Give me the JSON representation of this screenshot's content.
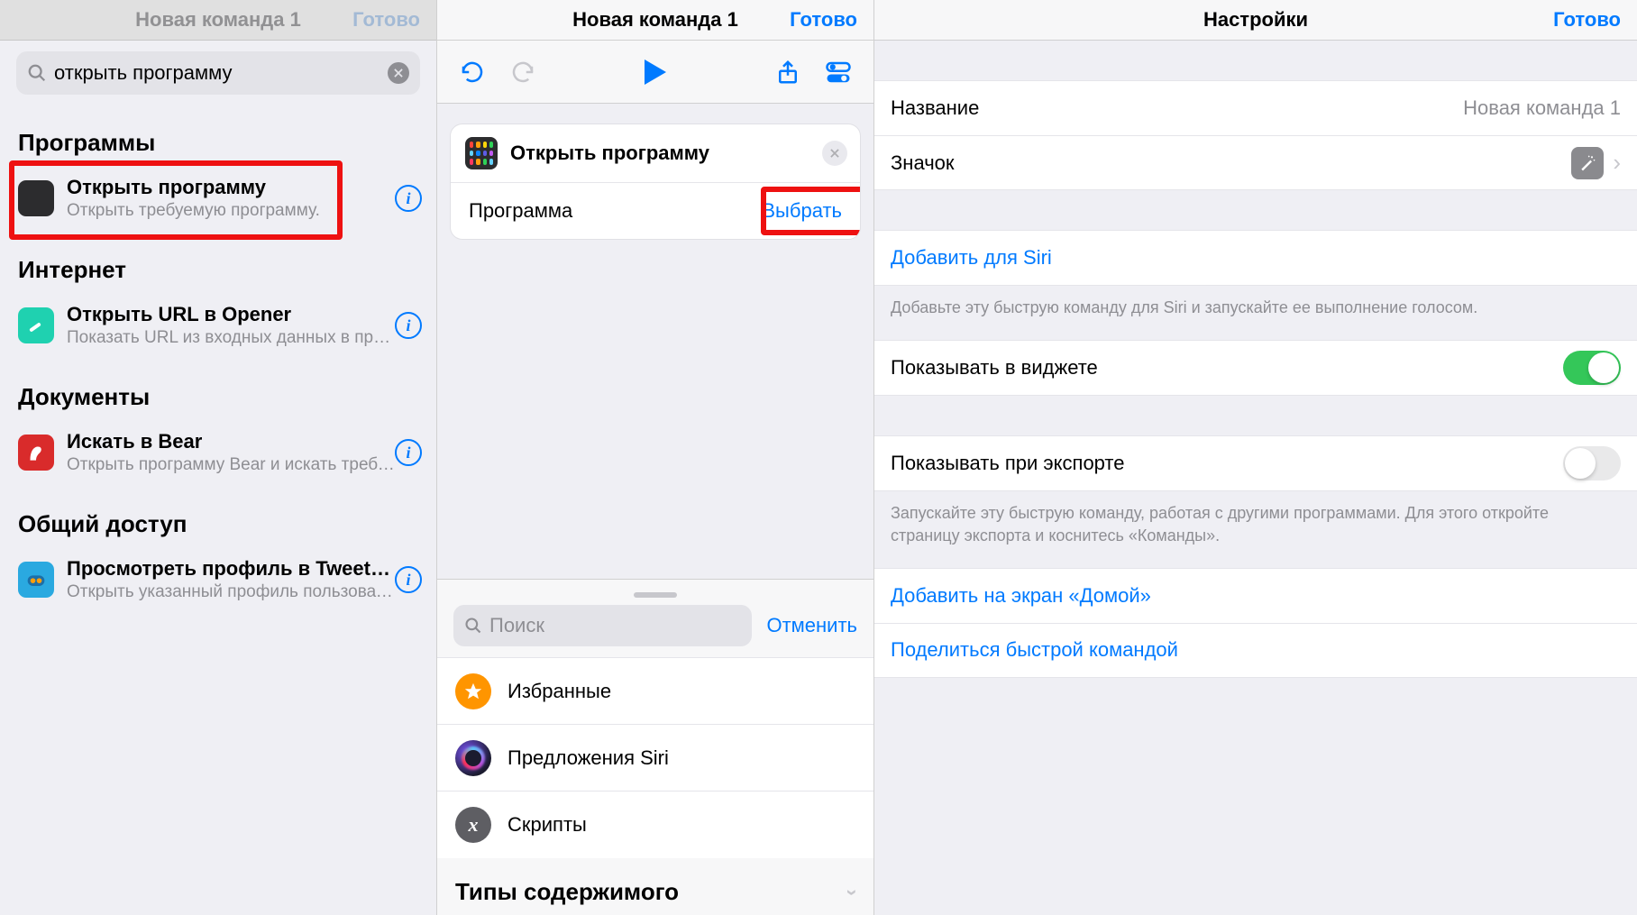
{
  "col1": {
    "header_title": "Новая команда 1",
    "header_done": "Готово",
    "search_value": "открыть программу",
    "sections": [
      {
        "title": "Программы",
        "items": [
          {
            "icon": "app-grid",
            "title": "Открыть программу",
            "sub": "Открыть требуемую программу."
          }
        ]
      },
      {
        "title": "Интернет",
        "items": [
          {
            "icon": "opener",
            "title": "Открыть URL в Opener",
            "sub": "Показать URL из входных данных в прог…"
          }
        ]
      },
      {
        "title": "Документы",
        "items": [
          {
            "icon": "bear",
            "title": "Искать в Bear",
            "sub": "Открыть программу Bear и искать требу…"
          }
        ]
      },
      {
        "title": "Общий доступ",
        "items": [
          {
            "icon": "tweetbot",
            "title": "Просмотреть профиль в Tweet…",
            "sub": "Открыть указанный профиль пользовате…"
          }
        ]
      }
    ]
  },
  "col2": {
    "header_title": "Новая команда 1",
    "header_done": "Готово",
    "card": {
      "title": "Открыть программу",
      "param_label": "Программа",
      "param_value": "Выбрать"
    },
    "drawer": {
      "search_placeholder": "Поиск",
      "cancel": "Отменить",
      "items": [
        {
          "icon": "star",
          "color": "#ff9500",
          "label": "Избранные"
        },
        {
          "icon": "siri",
          "color": "siri",
          "label": "Предложения Siri"
        },
        {
          "icon": "script",
          "color": "#5e5e63",
          "label": "Скрипты"
        }
      ],
      "section2": "Типы содержимого"
    }
  },
  "col3": {
    "header_title": "Настройки",
    "header_done": "Готово",
    "name_label": "Название",
    "name_value": "Новая команда 1",
    "icon_label": "Значок",
    "siri_add": "Добавить для Siri",
    "siri_footer": "Добавьте эту быструю команду для Siri и запускайте ее выполнение голосом.",
    "widget_label": "Показывать в виджете",
    "export_label": "Показывать при экспорте",
    "export_footer": "Запускайте эту быструю команду, работая с другими программами. Для этого откройте страницу экспорта и коснитесь «Команды».",
    "home_add": "Добавить на экран «Домой»",
    "share": "Поделиться быстрой командой"
  }
}
